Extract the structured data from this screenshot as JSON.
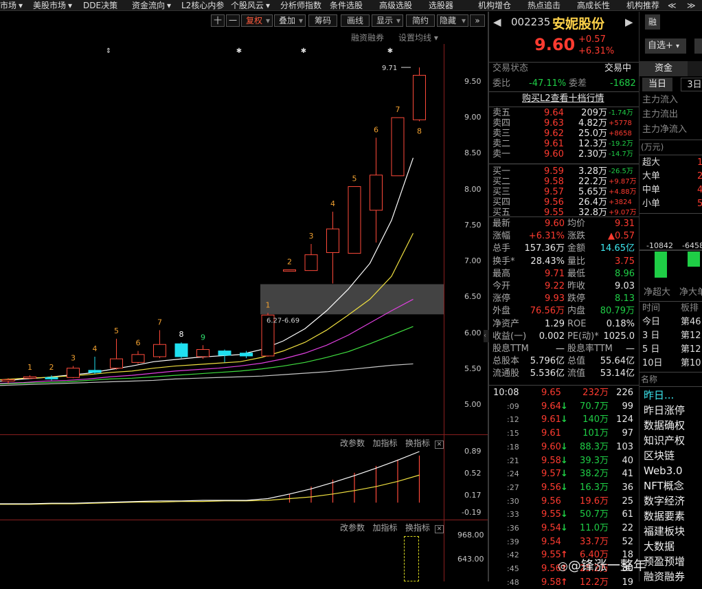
{
  "menu": {
    "items": [
      "市场",
      "美股市场",
      "DDE决策",
      "资金流向",
      "L2核心内参",
      "个股风云",
      "分析师指数",
      "条件选股",
      "高级选股",
      "选股器",
      "机构增仓",
      "热点追击",
      "高成长性",
      "机构推荐"
    ]
  },
  "toolbar": {
    "plus": "十",
    "minus": "一",
    "fuquan": "复权",
    "diejia": "叠加",
    "chouma": "筹码",
    "huaxian": "画线",
    "xianshi": "显示",
    "jianyue": "简约",
    "yincang": "隐藏",
    "expand": "»",
    "rzrq": "融资融券",
    "set_ma": "设置均线"
  },
  "price_axis": [
    "9.50",
    "9.00",
    "8.50",
    "8.00",
    "7.50",
    "7.00",
    "6.50",
    "6.00",
    "5.50",
    "5.00"
  ],
  "chart_data": {
    "type": "candlestick",
    "high_label": "9.71",
    "zone_label": "6.27-6.69",
    "zone_range": [
      6.27,
      6.69
    ],
    "ylim": [
      4.6,
      9.95
    ],
    "candles": [
      {
        "o": 5.36,
        "c": 5.36,
        "h": 5.38,
        "l": 5.3,
        "count": ""
      },
      {
        "o": 5.38,
        "c": 5.4,
        "h": 5.42,
        "l": 5.37,
        "count": "1"
      },
      {
        "o": 5.37,
        "c": 5.39,
        "h": 5.42,
        "l": 5.35,
        "count": "2"
      },
      {
        "o": 5.39,
        "c": 5.52,
        "h": 5.55,
        "l": 5.38,
        "count": "3"
      },
      {
        "o": 5.49,
        "c": 5.46,
        "h": 5.68,
        "l": 5.44,
        "count": "4"
      },
      {
        "o": 5.52,
        "c": 5.65,
        "h": 5.93,
        "l": 5.5,
        "count": "5"
      },
      {
        "o": 5.6,
        "c": 5.71,
        "h": 5.76,
        "l": 5.58,
        "count": "6"
      },
      {
        "o": 5.68,
        "c": 5.85,
        "h": 6.05,
        "l": 5.66,
        "count": "7"
      },
      {
        "o": 5.86,
        "c": 5.68,
        "h": 5.88,
        "l": 5.66,
        "count": "8"
      },
      {
        "o": 5.68,
        "c": 5.78,
        "h": 5.84,
        "l": 5.65,
        "count": "9"
      },
      {
        "o": 5.76,
        "c": 5.7,
        "h": 5.78,
        "l": 5.6,
        "count": ""
      },
      {
        "o": 5.73,
        "c": 5.69,
        "h": 5.76,
        "l": 5.66,
        "count": ""
      },
      {
        "o": 5.69,
        "c": 6.26,
        "h": 6.29,
        "l": 5.68,
        "count": "1"
      },
      {
        "o": 6.89,
        "c": 6.89,
        "h": 6.89,
        "l": 6.89,
        "count": "2"
      },
      {
        "o": 6.88,
        "c": 7.1,
        "h": 7.25,
        "l": 6.88,
        "count": "3"
      },
      {
        "o": 7.13,
        "c": 7.46,
        "h": 7.7,
        "l": 6.7,
        "count": "4"
      },
      {
        "o": 7.12,
        "c": 8.05,
        "h": 8.05,
        "l": 7.12,
        "count": "5"
      },
      {
        "o": 7.72,
        "c": 8.21,
        "h": 8.73,
        "l": 7.27,
        "count": "6"
      },
      {
        "o": 8.2,
        "c": 9.01,
        "h": 9.01,
        "l": 8.2,
        "count": "7"
      },
      {
        "o": 8.98,
        "c": 9.6,
        "h": 9.71,
        "l": 8.96,
        "count": "8"
      }
    ],
    "ma_lines": [
      {
        "color": "#ffffff",
        "values": [
          5.34,
          5.37,
          5.39,
          5.42,
          5.45,
          5.5,
          5.55,
          5.61,
          5.64,
          5.67,
          5.69,
          5.71,
          5.78,
          5.9,
          6.07,
          6.32,
          6.62,
          6.98,
          7.58,
          8.45
        ]
      },
      {
        "color": "#f0e040",
        "values": [
          5.36,
          5.38,
          5.39,
          5.41,
          5.43,
          5.46,
          5.48,
          5.52,
          5.55,
          5.57,
          5.59,
          5.61,
          5.67,
          5.76,
          5.88,
          6.05,
          6.26,
          6.48,
          6.8,
          7.4
        ]
      },
      {
        "color": "#e040e0",
        "values": [
          5.31,
          5.32,
          5.34,
          5.35,
          5.37,
          5.4,
          5.42,
          5.45,
          5.48,
          5.5,
          5.52,
          5.55,
          5.59,
          5.65,
          5.73,
          5.84,
          5.98,
          6.15,
          6.32,
          6.48
        ]
      },
      {
        "color": "#40e040",
        "values": [
          5.3,
          5.31,
          5.32,
          5.33,
          5.35,
          5.37,
          5.38,
          5.4,
          5.42,
          5.44,
          5.46,
          5.48,
          5.51,
          5.55,
          5.6,
          5.67,
          5.75,
          5.86,
          5.98,
          6.1
        ]
      },
      {
        "color": "#c8c8c8",
        "values": [
          5.28,
          5.29,
          5.3,
          5.31,
          5.32,
          5.33,
          5.34,
          5.35,
          5.37,
          5.38,
          5.39,
          5.4,
          5.41,
          5.43,
          5.45,
          5.47,
          5.5,
          5.53,
          5.56,
          5.58
        ]
      }
    ],
    "macd_axis": [
      "0.89",
      "0.52",
      "0.17",
      "-0.19"
    ],
    "macd": {
      "dif": [
        -0.02,
        -0.02,
        -0.01,
        -0.01,
        0.0,
        0.01,
        0.02,
        0.03,
        0.03,
        0.04,
        0.04,
        0.04,
        0.07,
        0.15,
        0.24,
        0.35,
        0.47,
        0.6,
        0.74,
        0.89
      ],
      "dea": [
        -0.03,
        -0.03,
        -0.02,
        -0.02,
        -0.01,
        0.0,
        0.01,
        0.01,
        0.02,
        0.02,
        0.03,
        0.03,
        0.04,
        0.07,
        0.1,
        0.15,
        0.21,
        0.28,
        0.37,
        0.48
      ],
      "hist": [
        0,
        0,
        0,
        0,
        0,
        0,
        0,
        0,
        0,
        0,
        0,
        0,
        0,
        0.15,
        0.28,
        0.4,
        0.52,
        0.64,
        0.75,
        0.82
      ]
    },
    "vol_axis": [
      "968.00",
      "643.00"
    ]
  },
  "sub_panel": {
    "gaicanshu": "改参数",
    "jiazhibiao": "加指标",
    "huanzhibiao": "换指标",
    "close": "✕"
  },
  "stock": {
    "code": "002235",
    "name": "安妮股份",
    "rong": "融",
    "price": "9.60",
    "change": "+0.57",
    "pct": "+6.31%",
    "zixuan": "自选+"
  },
  "trade_state": {
    "label": "交易状态",
    "value": "交易中"
  },
  "weibi": {
    "label": "委比",
    "value": "-47.11%",
    "label2": "委差",
    "value2": "-1682"
  },
  "buy_l2": "购买L2查看十档行情",
  "asks": [
    {
      "label": "卖五",
      "price": "9.64",
      "vol": "209万",
      "chg": "-1.74万"
    },
    {
      "label": "卖四",
      "price": "9.63",
      "vol": "4.82万",
      "chg": "+5778"
    },
    {
      "label": "卖三",
      "price": "9.62",
      "vol": "25.0万",
      "chg": "+8658"
    },
    {
      "label": "卖二",
      "price": "9.61",
      "vol": "12.3万",
      "chg": "-19.2万"
    },
    {
      "label": "卖一",
      "price": "9.60",
      "vol": "2.30万",
      "chg": "-14.7万"
    }
  ],
  "bids": [
    {
      "label": "买一",
      "price": "9.59",
      "vol": "3.28万",
      "chg": "-26.5万"
    },
    {
      "label": "买二",
      "price": "9.58",
      "vol": "22.2万",
      "chg": "+9.87万"
    },
    {
      "label": "买三",
      "price": "9.57",
      "vol": "5.65万",
      "chg": "+4.88万"
    },
    {
      "label": "买四",
      "price": "9.56",
      "vol": "26.4万",
      "chg": "+3824"
    },
    {
      "label": "买五",
      "price": "9.55",
      "vol": "32.8万",
      "chg": "+9.07万"
    }
  ],
  "stats": [
    {
      "l1": "最新",
      "v1": "9.60",
      "c1": "red",
      "l2": "均价",
      "v2": "9.31",
      "c2": "red"
    },
    {
      "l1": "涨幅",
      "v1": "+6.31%",
      "c1": "red",
      "l2": "涨跌",
      "v2": "▲0.57",
      "c2": "red"
    },
    {
      "l1": "总手",
      "v1": "157.36万",
      "c1": "white",
      "l2": "金额",
      "v2": "14.65亿",
      "c2": "cyan"
    },
    {
      "l1": "换手*",
      "v1": "28.43%",
      "c1": "white",
      "l2": "量比",
      "v2": "3.75",
      "c2": "red"
    },
    {
      "l1": "最高",
      "v1": "9.71",
      "c1": "red",
      "l2": "最低",
      "v2": "8.96",
      "c2": "green"
    },
    {
      "l1": "今开",
      "v1": "9.22",
      "c1": "red",
      "l2": "昨收",
      "v2": "9.03",
      "c2": "white"
    },
    {
      "l1": "涨停",
      "v1": "9.93",
      "c1": "red",
      "l2": "跌停",
      "v2": "8.13",
      "c2": "green"
    },
    {
      "l1": "外盘",
      "v1": "76.56万",
      "c1": "red",
      "l2": "内盘",
      "v2": "80.79万",
      "c2": "green"
    },
    {
      "l1": "净资产",
      "v1": "1.29",
      "c1": "white",
      "l2": "ROE",
      "v2": "0.18%",
      "c2": "white"
    },
    {
      "l1": "收益(一)",
      "v1": "0.002",
      "c1": "white",
      "l2": "PE(动)*",
      "v2": "1025.0",
      "c2": "white"
    },
    {
      "l1": "股息TTM",
      "v1": "—",
      "c1": "white",
      "l2": "股息率TTM",
      "v2": "—",
      "c2": "white"
    },
    {
      "l1": "总股本",
      "v1": "5.796亿",
      "c1": "white",
      "l2": "总值",
      "v2": "55.64亿",
      "c2": "white"
    },
    {
      "l1": "流通股",
      "v1": "5.536亿",
      "c1": "white",
      "l2": "流值",
      "v2": "53.14亿",
      "c2": "white"
    }
  ],
  "ticks": [
    {
      "t": "10:08",
      "p": "9.65",
      "pc": "red",
      "a": "",
      "v": "232万",
      "vc": "red",
      "n": "226"
    },
    {
      "t": ":09",
      "p": "9.64",
      "pc": "red",
      "a": "↓",
      "v": "70.7万",
      "vc": "green",
      "n": "99"
    },
    {
      "t": ":12",
      "p": "9.61",
      "pc": "red",
      "a": "↓",
      "v": "140万",
      "vc": "green",
      "n": "124"
    },
    {
      "t": ":15",
      "p": "9.61",
      "pc": "red",
      "a": "",
      "v": "101万",
      "vc": "green",
      "n": "97"
    },
    {
      "t": ":18",
      "p": "9.60",
      "pc": "red",
      "a": "↓",
      "v": "88.3万",
      "vc": "green",
      "n": "103"
    },
    {
      "t": ":21",
      "p": "9.58",
      "pc": "red",
      "a": "↓",
      "v": "39.3万",
      "vc": "green",
      "n": "40"
    },
    {
      "t": ":24",
      "p": "9.57",
      "pc": "red",
      "a": "↓",
      "v": "38.2万",
      "vc": "green",
      "n": "41"
    },
    {
      "t": ":27",
      "p": "9.56",
      "pc": "red",
      "a": "↓",
      "v": "16.3万",
      "vc": "green",
      "n": "36"
    },
    {
      "t": ":30",
      "p": "9.56",
      "pc": "red",
      "a": "",
      "v": "19.6万",
      "vc": "red",
      "n": "25"
    },
    {
      "t": ":33",
      "p": "9.55",
      "pc": "red",
      "a": "↓",
      "v": "50.7万",
      "vc": "green",
      "n": "61"
    },
    {
      "t": ":36",
      "p": "9.54",
      "pc": "red",
      "a": "↓",
      "v": "11.0万",
      "vc": "green",
      "n": "22"
    },
    {
      "t": ":39",
      "p": "9.54",
      "pc": "red",
      "a": "",
      "v": "33.7万",
      "vc": "red",
      "n": "52"
    },
    {
      "t": ":42",
      "p": "9.55",
      "pc": "red",
      "a": "↑",
      "v": "6.40万",
      "vc": "red",
      "n": "18"
    },
    {
      "t": ":45",
      "p": "9.56",
      "pc": "red",
      "a": "↑",
      "v": "25.2万",
      "vc": "red",
      "n": "30"
    },
    {
      "t": ":48",
      "p": "9.58",
      "pc": "red",
      "a": "↑",
      "v": "12.2万",
      "vc": "red",
      "n": "19"
    }
  ],
  "fund": {
    "tab1": "资金",
    "sub1": "当日",
    "sub2": "3日",
    "rows": [
      "主力流入",
      "主力流出",
      "主力净流入"
    ],
    "unit": "(万元)",
    "sizes": [
      {
        "l": "超大",
        "v": "1"
      },
      {
        "l": "大单",
        "v": "2"
      },
      {
        "l": "中单",
        "v": "4"
      },
      {
        "l": "小单",
        "v": "5"
      }
    ],
    "bar1": "-10842",
    "bar2": "-6458",
    "bar1_label": "净超大",
    "bar2_label": "净大单",
    "rank_header": "时间",
    "rank_header2": "板排",
    "ranks": [
      {
        "t": "今日",
        "v": "第46"
      },
      {
        "t": "3 日",
        "v": "第12"
      },
      {
        "t": "5 日",
        "v": "第12"
      },
      {
        "t": "10日",
        "v": "第10"
      }
    ],
    "concept_header": "名称",
    "concepts": [
      "昨日...",
      "昨日涨停",
      "数据确权",
      "知识产权",
      "区块链",
      "Web3.0",
      "NFT概念",
      "数字经济",
      "数据要素",
      "福建板块",
      "大数据",
      "预盈预增",
      "融资融券"
    ]
  },
  "watermark": "@锋涨一整年"
}
